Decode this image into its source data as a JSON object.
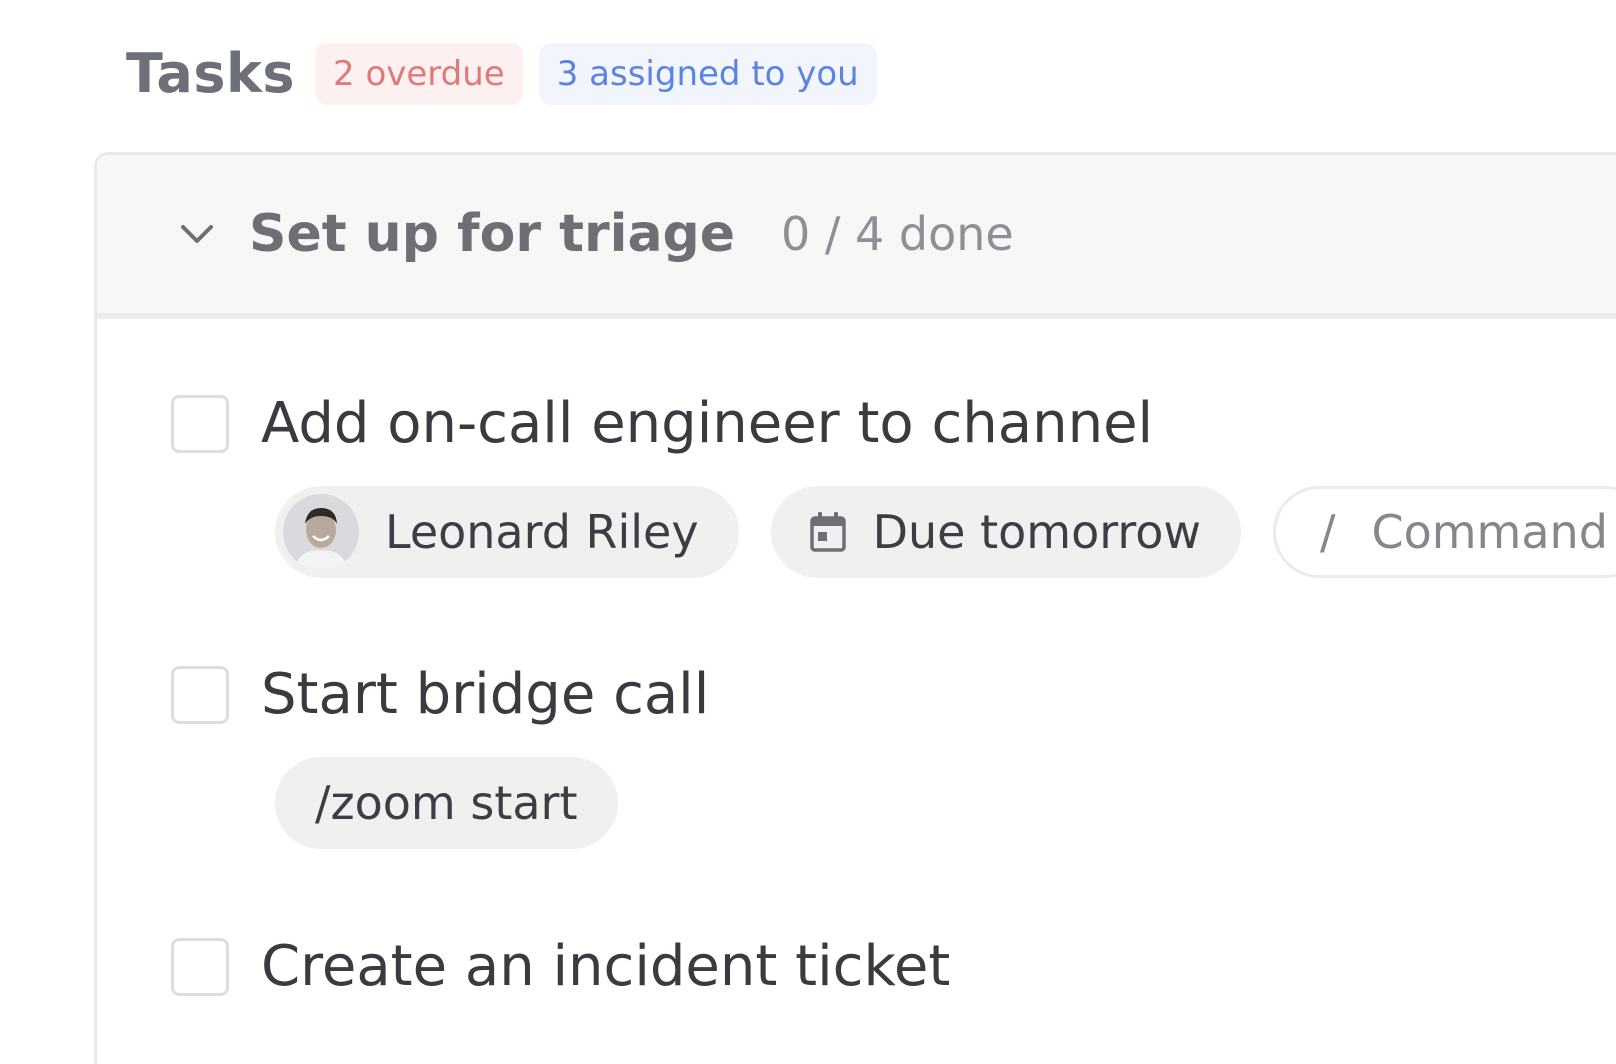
{
  "header": {
    "title": "Tasks",
    "overdue_badge": "2 overdue",
    "assigned_badge": "3 assigned to you"
  },
  "group": {
    "title": "Set up for triage",
    "progress": "0 / 4 done",
    "expanded": true
  },
  "tasks": [
    {
      "label": "Add on-call engineer to channel",
      "checked": false,
      "assignee": "Leonard Riley",
      "due": "Due tomorrow",
      "command_slash": "/",
      "command_placeholder": "Command"
    },
    {
      "label": "Start bridge call",
      "checked": false,
      "command": "/zoom start"
    },
    {
      "label": "Create an incident ticket",
      "checked": false
    }
  ],
  "colors": {
    "overdue_text": "#e07a7a",
    "overdue_bg": "#fcf0f0",
    "assigned_text": "#5b84e0",
    "assigned_bg": "#f2f5fc",
    "header_bg": "#f7f7f8"
  },
  "icons": {
    "group_toggle": "chevron-down-icon",
    "due": "calendar-icon"
  }
}
